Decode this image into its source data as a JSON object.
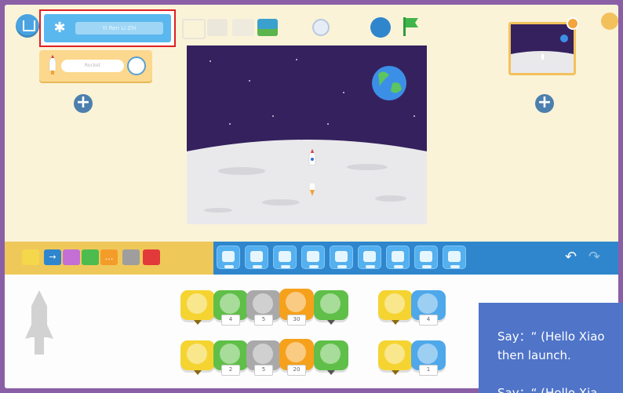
{
  "toolbar": {
    "device_name": "Yi Ren Li Zhi",
    "bluetooth_symbol": "β"
  },
  "sprites": {
    "selected_sprite_name": "Rocket"
  },
  "add_symbol": "+",
  "undo_symbol": "↶",
  "redo_symbol": "↷",
  "script": {
    "row1_values": [
      "",
      "4",
      "5",
      "30",
      "",
      "",
      "4"
    ],
    "row2_values": [
      "",
      "2",
      "5",
      "20",
      "",
      "",
      "1"
    ]
  },
  "instruction": {
    "line1": "Say：“ (Hello Xiao",
    "line2": "then launch.",
    "line3": "Say：“ (Hello Xia"
  },
  "colors": {
    "frame": "#8a5fa6",
    "accent_blue": "#2f86cc",
    "instruction_bg": "#4f74c8",
    "highlight_border": "#e02020"
  }
}
